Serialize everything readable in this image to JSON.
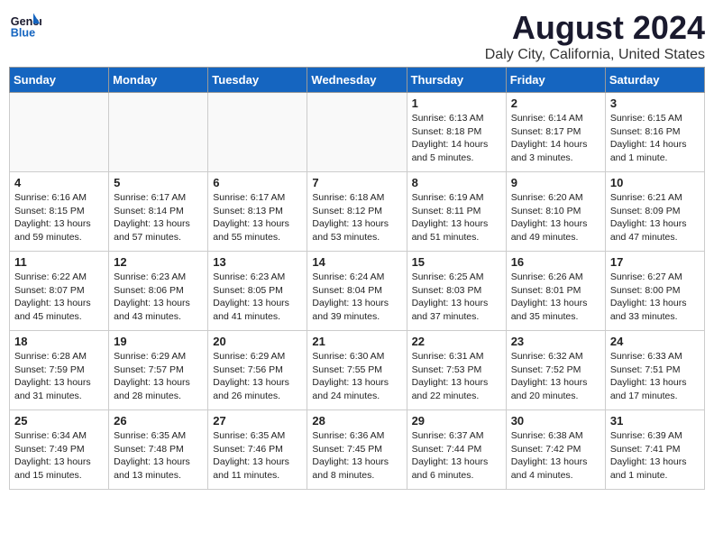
{
  "header": {
    "logo_line1": "General",
    "logo_line2": "Blue",
    "month_year": "August 2024",
    "location": "Daly City, California, United States"
  },
  "weekdays": [
    "Sunday",
    "Monday",
    "Tuesday",
    "Wednesday",
    "Thursday",
    "Friday",
    "Saturday"
  ],
  "weeks": [
    [
      {
        "day": "",
        "info": ""
      },
      {
        "day": "",
        "info": ""
      },
      {
        "day": "",
        "info": ""
      },
      {
        "day": "",
        "info": ""
      },
      {
        "day": "1",
        "info": "Sunrise: 6:13 AM\nSunset: 8:18 PM\nDaylight: 14 hours\nand 5 minutes."
      },
      {
        "day": "2",
        "info": "Sunrise: 6:14 AM\nSunset: 8:17 PM\nDaylight: 14 hours\nand 3 minutes."
      },
      {
        "day": "3",
        "info": "Sunrise: 6:15 AM\nSunset: 8:16 PM\nDaylight: 14 hours\nand 1 minute."
      }
    ],
    [
      {
        "day": "4",
        "info": "Sunrise: 6:16 AM\nSunset: 8:15 PM\nDaylight: 13 hours\nand 59 minutes."
      },
      {
        "day": "5",
        "info": "Sunrise: 6:17 AM\nSunset: 8:14 PM\nDaylight: 13 hours\nand 57 minutes."
      },
      {
        "day": "6",
        "info": "Sunrise: 6:17 AM\nSunset: 8:13 PM\nDaylight: 13 hours\nand 55 minutes."
      },
      {
        "day": "7",
        "info": "Sunrise: 6:18 AM\nSunset: 8:12 PM\nDaylight: 13 hours\nand 53 minutes."
      },
      {
        "day": "8",
        "info": "Sunrise: 6:19 AM\nSunset: 8:11 PM\nDaylight: 13 hours\nand 51 minutes."
      },
      {
        "day": "9",
        "info": "Sunrise: 6:20 AM\nSunset: 8:10 PM\nDaylight: 13 hours\nand 49 minutes."
      },
      {
        "day": "10",
        "info": "Sunrise: 6:21 AM\nSunset: 8:09 PM\nDaylight: 13 hours\nand 47 minutes."
      }
    ],
    [
      {
        "day": "11",
        "info": "Sunrise: 6:22 AM\nSunset: 8:07 PM\nDaylight: 13 hours\nand 45 minutes."
      },
      {
        "day": "12",
        "info": "Sunrise: 6:23 AM\nSunset: 8:06 PM\nDaylight: 13 hours\nand 43 minutes."
      },
      {
        "day": "13",
        "info": "Sunrise: 6:23 AM\nSunset: 8:05 PM\nDaylight: 13 hours\nand 41 minutes."
      },
      {
        "day": "14",
        "info": "Sunrise: 6:24 AM\nSunset: 8:04 PM\nDaylight: 13 hours\nand 39 minutes."
      },
      {
        "day": "15",
        "info": "Sunrise: 6:25 AM\nSunset: 8:03 PM\nDaylight: 13 hours\nand 37 minutes."
      },
      {
        "day": "16",
        "info": "Sunrise: 6:26 AM\nSunset: 8:01 PM\nDaylight: 13 hours\nand 35 minutes."
      },
      {
        "day": "17",
        "info": "Sunrise: 6:27 AM\nSunset: 8:00 PM\nDaylight: 13 hours\nand 33 minutes."
      }
    ],
    [
      {
        "day": "18",
        "info": "Sunrise: 6:28 AM\nSunset: 7:59 PM\nDaylight: 13 hours\nand 31 minutes."
      },
      {
        "day": "19",
        "info": "Sunrise: 6:29 AM\nSunset: 7:57 PM\nDaylight: 13 hours\nand 28 minutes."
      },
      {
        "day": "20",
        "info": "Sunrise: 6:29 AM\nSunset: 7:56 PM\nDaylight: 13 hours\nand 26 minutes."
      },
      {
        "day": "21",
        "info": "Sunrise: 6:30 AM\nSunset: 7:55 PM\nDaylight: 13 hours\nand 24 minutes."
      },
      {
        "day": "22",
        "info": "Sunrise: 6:31 AM\nSunset: 7:53 PM\nDaylight: 13 hours\nand 22 minutes."
      },
      {
        "day": "23",
        "info": "Sunrise: 6:32 AM\nSunset: 7:52 PM\nDaylight: 13 hours\nand 20 minutes."
      },
      {
        "day": "24",
        "info": "Sunrise: 6:33 AM\nSunset: 7:51 PM\nDaylight: 13 hours\nand 17 minutes."
      }
    ],
    [
      {
        "day": "25",
        "info": "Sunrise: 6:34 AM\nSunset: 7:49 PM\nDaylight: 13 hours\nand 15 minutes."
      },
      {
        "day": "26",
        "info": "Sunrise: 6:35 AM\nSunset: 7:48 PM\nDaylight: 13 hours\nand 13 minutes."
      },
      {
        "day": "27",
        "info": "Sunrise: 6:35 AM\nSunset: 7:46 PM\nDaylight: 13 hours\nand 11 minutes."
      },
      {
        "day": "28",
        "info": "Sunrise: 6:36 AM\nSunset: 7:45 PM\nDaylight: 13 hours\nand 8 minutes."
      },
      {
        "day": "29",
        "info": "Sunrise: 6:37 AM\nSunset: 7:44 PM\nDaylight: 13 hours\nand 6 minutes."
      },
      {
        "day": "30",
        "info": "Sunrise: 6:38 AM\nSunset: 7:42 PM\nDaylight: 13 hours\nand 4 minutes."
      },
      {
        "day": "31",
        "info": "Sunrise: 6:39 AM\nSunset: 7:41 PM\nDaylight: 13 hours\nand 1 minute."
      }
    ]
  ]
}
